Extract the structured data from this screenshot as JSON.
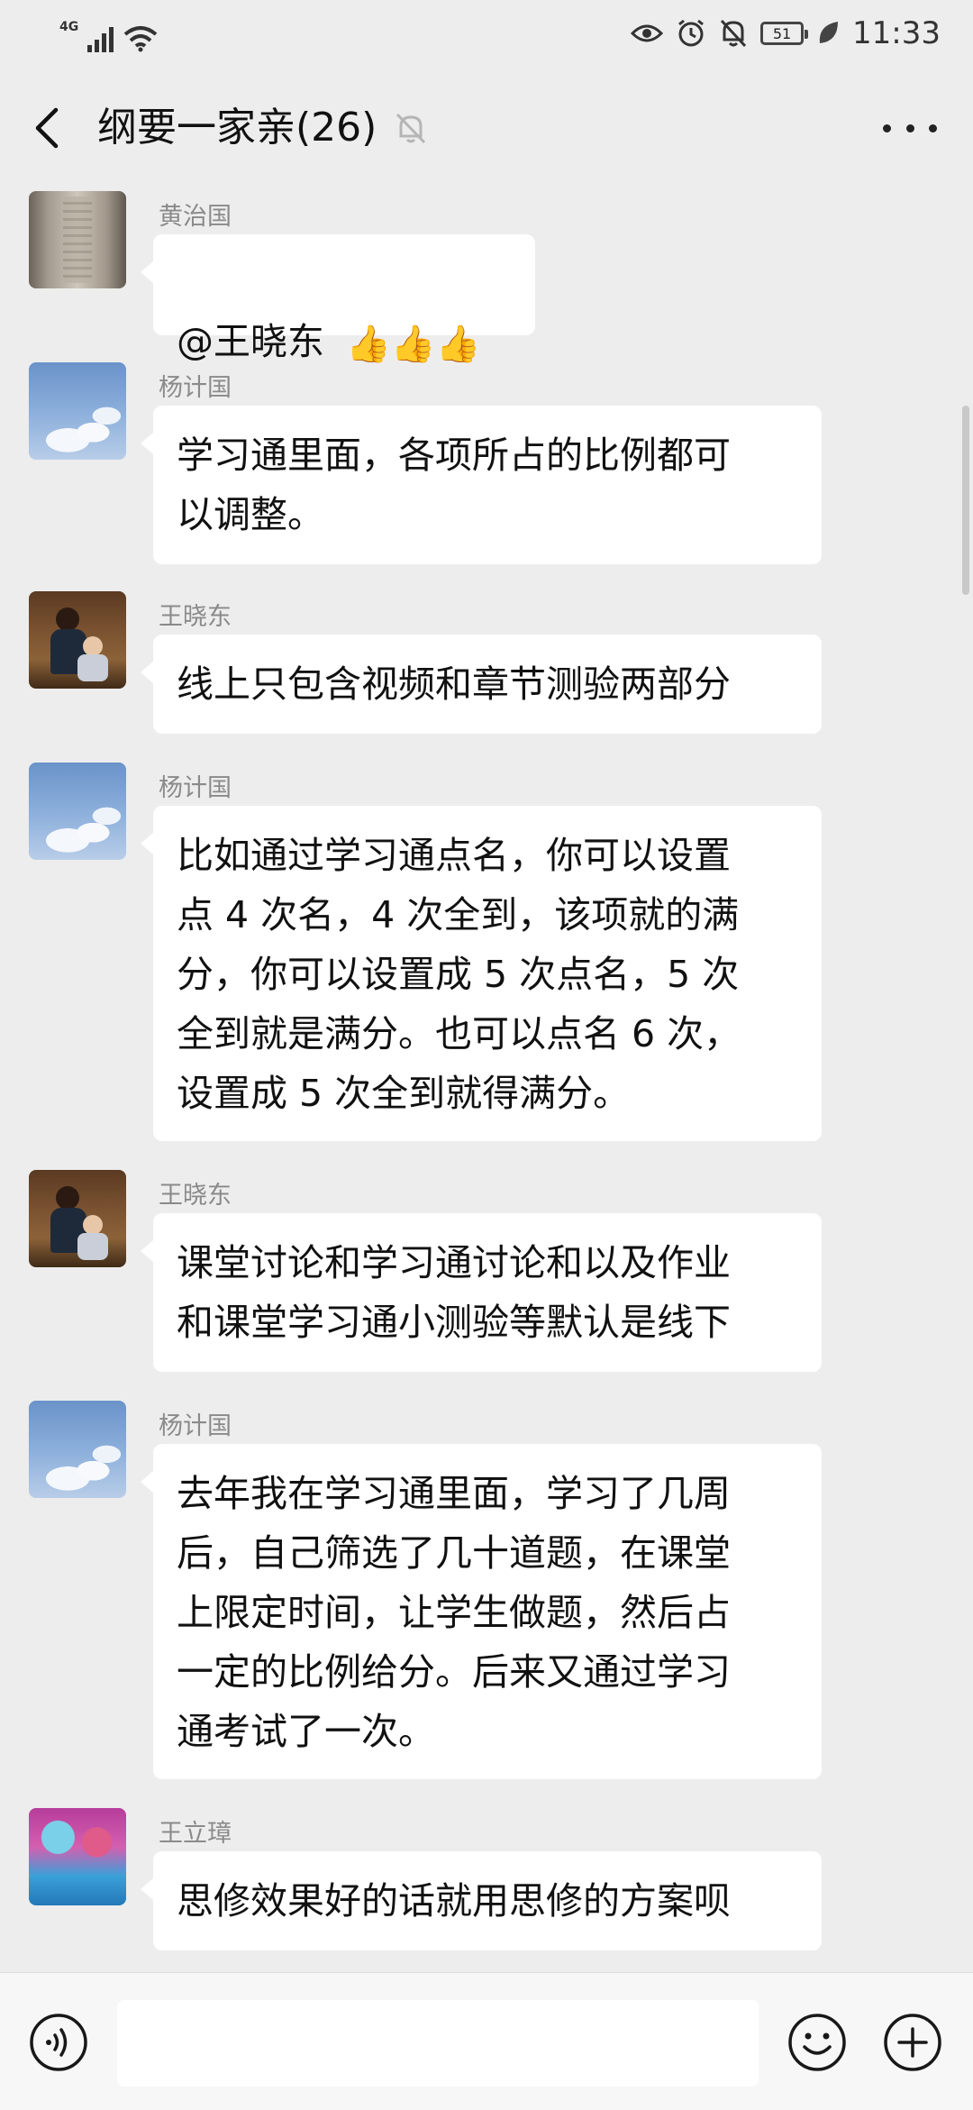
{
  "status_bar": {
    "network": "4G",
    "battery": "51",
    "time": "11:33",
    "icons": [
      "eye-icon",
      "alarm-icon",
      "mute-bell-icon",
      "leaf-icon"
    ]
  },
  "header": {
    "title": "纲要一家亲(26)",
    "back_icon": "chevron-left-icon",
    "mute_icon": "mute-bell-icon",
    "more_icon": "more-dots-icon"
  },
  "messages": [
    {
      "sender": "黄治国",
      "text": "@王晓东",
      "reactions": "👍👍👍"
    },
    {
      "sender": "杨计国",
      "text": "学习通里面，各项所占的比例都可\n以调整。"
    },
    {
      "sender": "王晓东",
      "text": "线上只包含视频和章节测验两部分"
    },
    {
      "sender": "杨计国",
      "text": "比如通过学习通点名，你可以设置\n点 4 次名，4 次全到，该项就的满\n分，你可以设置成 5 次点名，5 次\n全到就是满分。也可以点名 6 次，\n设置成 5 次全到就得满分。"
    },
    {
      "sender": "王晓东",
      "text": "课堂讨论和学习通讨论和以及作业\n和课堂学习通小测验等默认是线下"
    },
    {
      "sender": "杨计国",
      "text": "去年我在学习通里面，学习了几周\n后，自己筛选了几十道题，在课堂\n上限定时间，让学生做题，然后占\n一定的比例给分。后来又通过学习\n通考试了一次。"
    },
    {
      "sender": "王立璋",
      "text": "思修效果好的话就用思修的方案呗"
    }
  ],
  "input_bar": {
    "placeholder": "",
    "voice_icon": "voice-icon",
    "emoji_icon": "emoji-icon",
    "plus_icon": "plus-icon"
  },
  "colors": {
    "background": "#ededed",
    "bubble": "#ffffff",
    "sender": "#8a8a8a"
  }
}
